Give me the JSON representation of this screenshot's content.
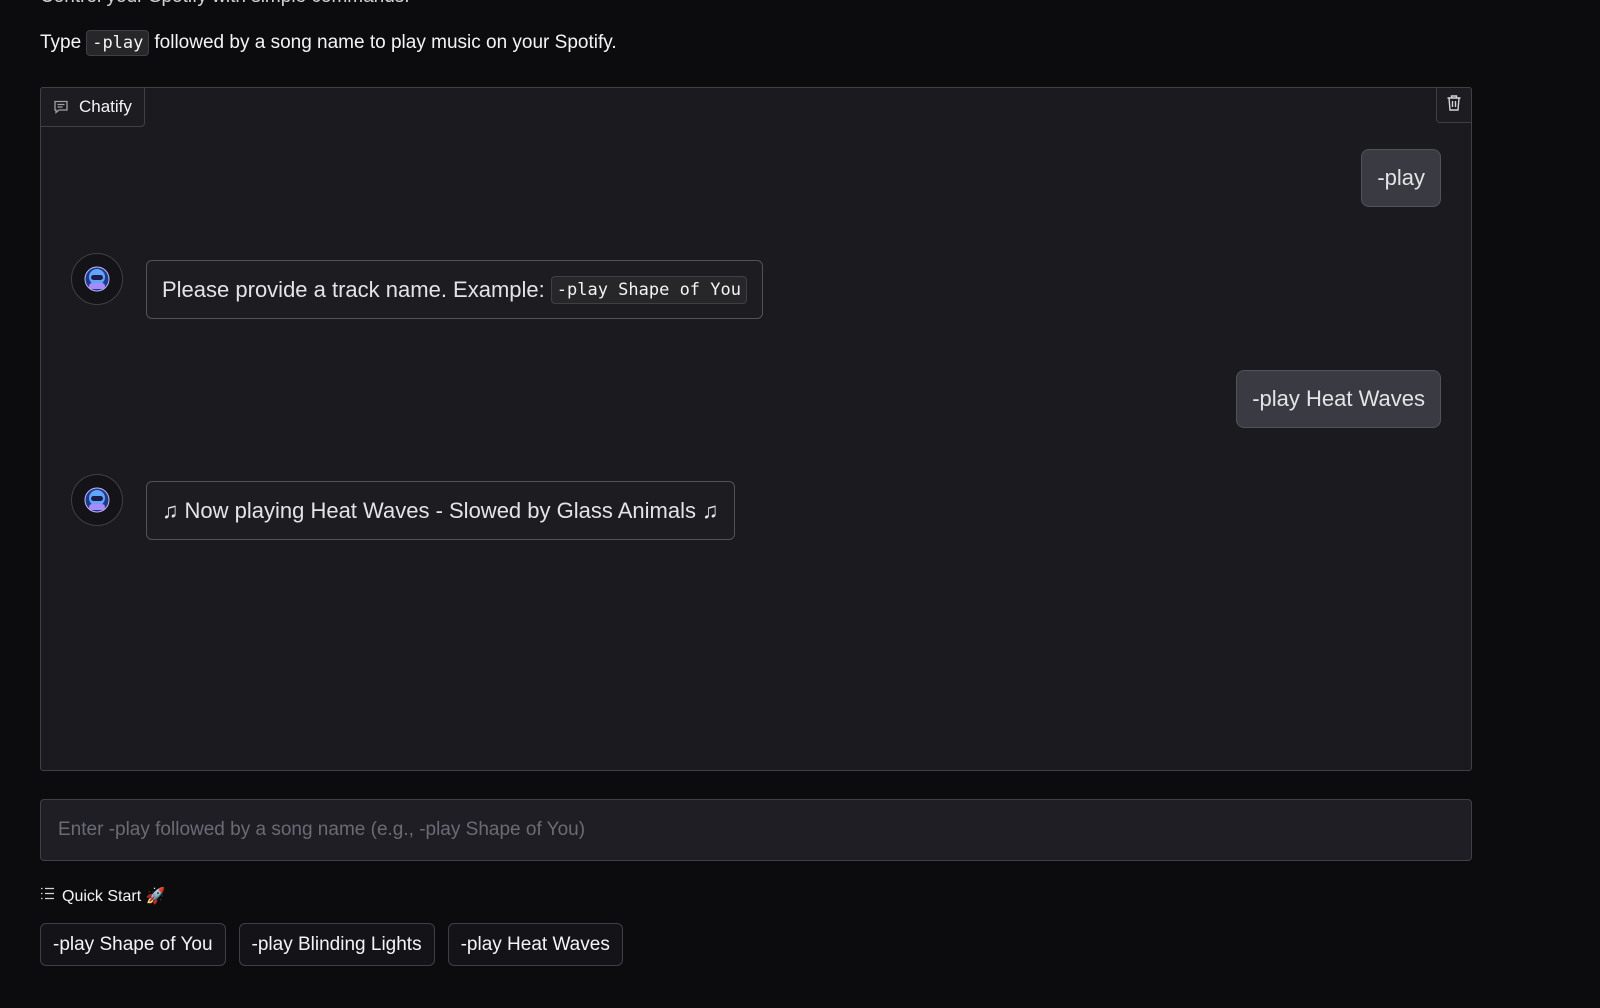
{
  "header": {
    "top_clipped_text": "Control your Spotify with simple commands.",
    "instruction_prefix": "Type",
    "instruction_code": "-play",
    "instruction_suffix": "followed by a song name to play music on your Spotify."
  },
  "chatbot": {
    "label": "Chatify",
    "label_icon": "chat-bubble-icon",
    "clear_icon": "trash-icon",
    "messages": [
      {
        "role": "user",
        "text": "-play"
      },
      {
        "role": "bot",
        "text": "Please provide a track name. Example:",
        "code": "-play Shape of You"
      },
      {
        "role": "user",
        "text": "-play Heat Waves"
      },
      {
        "role": "bot",
        "prefix_note": "♫",
        "text": "Now playing Heat Waves - Slowed by Glass Animals",
        "suffix_note": "♫"
      }
    ]
  },
  "input": {
    "placeholder": "Enter -play followed by a song name (e.g., -play Shape of You)",
    "value": ""
  },
  "quick_start": {
    "title": "Quick Start 🚀",
    "icon": "list-icon",
    "examples": [
      "-play Shape of You",
      "-play Blinding Lights",
      "-play Heat Waves"
    ]
  },
  "colors": {
    "page_bg": "#0c0c0f",
    "panel_bg": "#1a1a1f",
    "user_bubble": "#3a3a42",
    "border": "#3f3f46"
  }
}
